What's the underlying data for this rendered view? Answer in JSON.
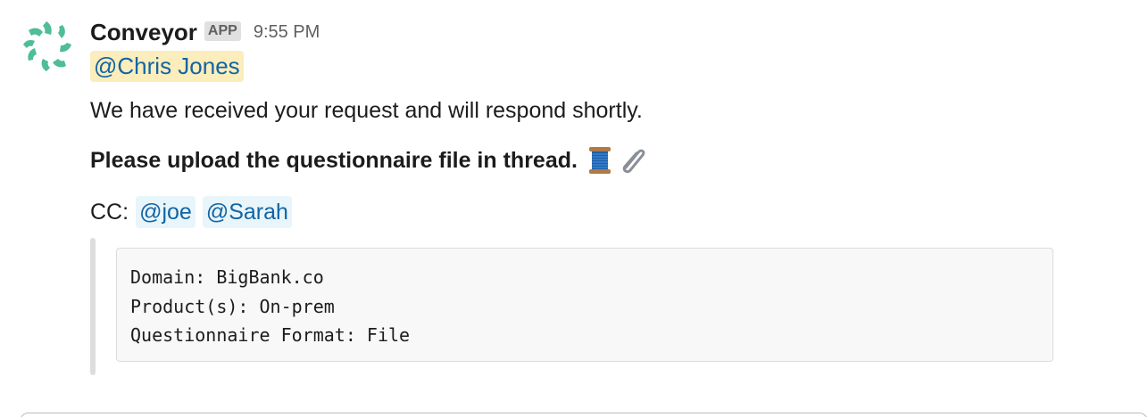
{
  "message": {
    "sender": "Conveyor",
    "badge": "APP",
    "timestamp": "9:55 PM",
    "mention_primary": "@Chris Jones",
    "line1": "We have received your request and will respond shortly.",
    "line2": "Please upload the questionnaire file in thread.",
    "line2_emoji": [
      "spool-of-thread-icon",
      "paperclip-icon"
    ],
    "cc_label": "CC:",
    "cc_mentions": [
      "@joe",
      "@Sarah"
    ],
    "code_lines": [
      "Domain: BigBank.co",
      "Product(s): On-prem",
      "Questionnaire Format: File"
    ]
  },
  "colors": {
    "brand_avatar": "#4fbc9a",
    "mention_text": "#1264a3",
    "mention_self_bg": "#fbedbc",
    "mention_other_bg": "#e8f5fa",
    "code_bg": "#f8f8f8"
  }
}
